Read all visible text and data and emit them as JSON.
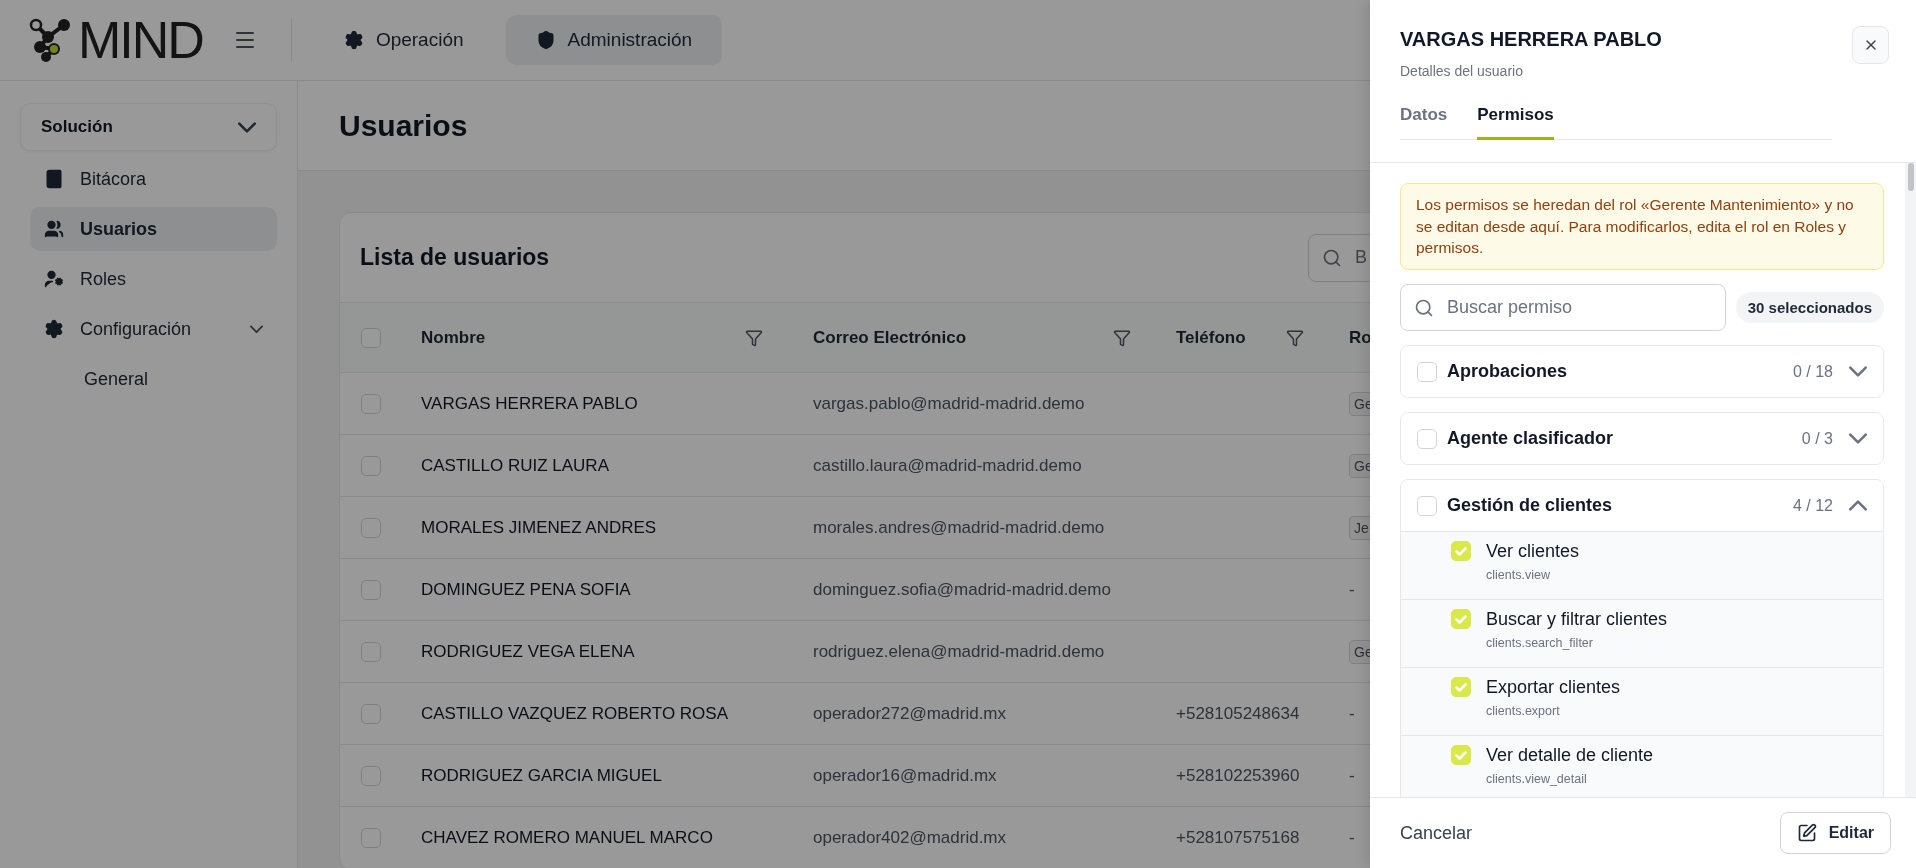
{
  "brand": {
    "name": "MIND"
  },
  "nav_tabs": [
    {
      "label": "Operación",
      "selected": false
    },
    {
      "label": "Administración",
      "selected": true
    }
  ],
  "sidebar": {
    "section": "Solución",
    "items": [
      {
        "label": "Bitácora",
        "selected": false
      },
      {
        "label": "Usuarios",
        "selected": true
      },
      {
        "label": "Roles",
        "selected": false
      },
      {
        "label": "Configuración",
        "selected": false,
        "expanded": true,
        "children": [
          {
            "label": "General",
            "selected": false
          }
        ]
      }
    ]
  },
  "page_title": "Usuarios",
  "table": {
    "title": "Lista de usuarios",
    "search": {
      "placeholder": "B"
    },
    "all_checked": false,
    "columns": [
      {
        "label": "Nombre",
        "filter": true
      },
      {
        "label": "Correo Electrónico",
        "filter": true
      },
      {
        "label": "Teléfono",
        "filter": true
      },
      {
        "label": "Ro",
        "filter": false
      }
    ],
    "rows": [
      {
        "checked": false,
        "name": "VARGAS HERRERA PABLO",
        "email": "vargas.pablo@madrid-madrid.demo",
        "phone": "",
        "role": {
          "kind": "badge",
          "text": "Ge"
        }
      },
      {
        "checked": false,
        "name": "CASTILLO RUIZ LAURA",
        "email": "castillo.laura@madrid-madrid.demo",
        "phone": "",
        "role": {
          "kind": "badge",
          "text": "Ge"
        }
      },
      {
        "checked": false,
        "name": "MORALES JIMENEZ ANDRES",
        "email": "morales.andres@madrid-madrid.demo",
        "phone": "",
        "role": {
          "kind": "badge",
          "text": "Je"
        }
      },
      {
        "checked": false,
        "name": "DOMINGUEZ PENA SOFIA",
        "email": "dominguez.sofia@madrid-madrid.demo",
        "phone": "",
        "role": {
          "kind": "text",
          "text": "-"
        }
      },
      {
        "checked": false,
        "name": "RODRIGUEZ VEGA ELENA",
        "email": "rodriguez.elena@madrid-madrid.demo",
        "phone": "",
        "role": {
          "kind": "badge",
          "text": "Ge"
        }
      },
      {
        "checked": false,
        "name": "CASTILLO VAZQUEZ ROBERTO ROSA",
        "email": "operador272@madrid.mx",
        "phone": "+528105248634",
        "role": {
          "kind": "text",
          "text": "-"
        }
      },
      {
        "checked": false,
        "name": "RODRIGUEZ GARCIA MIGUEL",
        "email": "operador16@madrid.mx",
        "phone": "+528102253960",
        "role": {
          "kind": "text",
          "text": "-"
        }
      },
      {
        "checked": false,
        "name": "CHAVEZ ROMERO MANUEL MARCO",
        "email": "operador402@madrid.mx",
        "phone": "+528107575168",
        "role": {
          "kind": "text",
          "text": "-"
        }
      }
    ]
  },
  "drawer": {
    "title": "VARGAS HERRERA PABLO",
    "subtitle": "Detalles del usuario",
    "tabs": [
      {
        "label": "Datos",
        "selected": false
      },
      {
        "label": "Permisos",
        "selected": true
      }
    ],
    "notice": "Los permisos se heredan del rol «Gerente Mantenimiento» y no se editan desde aquí. Para modificarlos, edita el rol en Roles y permisos.",
    "search": {
      "placeholder": "Buscar permiso"
    },
    "selected_count": "30 seleccionados",
    "groups": [
      {
        "name": "Aprobaciones",
        "count": "0 / 18",
        "checked": false,
        "expanded": false
      },
      {
        "name": "Agente clasificador",
        "count": "0 / 3",
        "checked": false,
        "expanded": false
      },
      {
        "name": "Gestión de clientes",
        "count": "4 / 12",
        "checked": false,
        "expanded": true,
        "permissions": [
          {
            "label": "Ver clientes",
            "code": "clients.view",
            "checked": true
          },
          {
            "label": "Buscar y filtrar clientes",
            "code": "clients.search_filter",
            "checked": true
          },
          {
            "label": "Exportar clientes",
            "code": "clients.export",
            "checked": true
          },
          {
            "label": "Ver detalle de cliente",
            "code": "clients.view_detail",
            "checked": true
          }
        ]
      }
    ],
    "footer": {
      "cancel": "Cancelar",
      "edit": "Editar"
    }
  }
}
